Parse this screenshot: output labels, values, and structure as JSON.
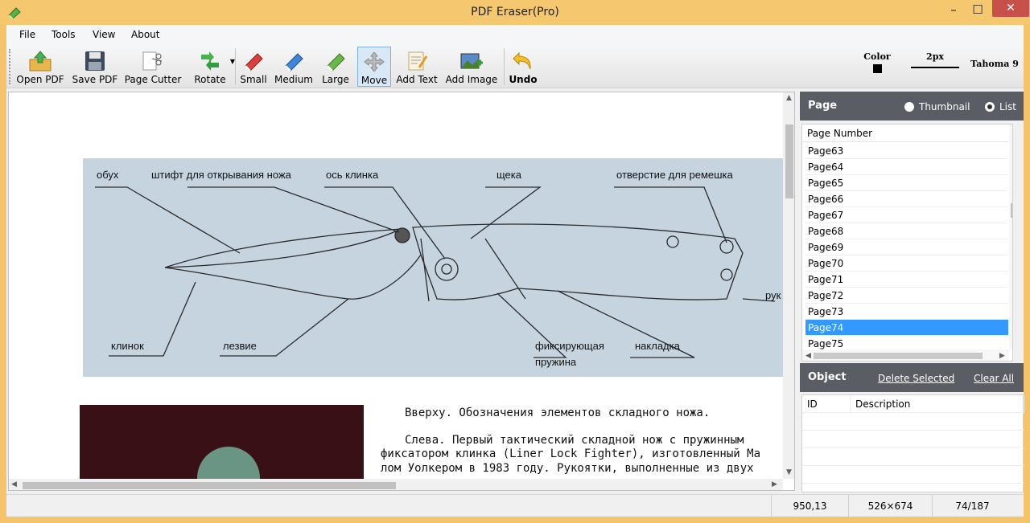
{
  "window": {
    "title": "PDF Eraser(Pro)",
    "min_glyph": "–",
    "max_glyph": "☐",
    "close_glyph": "✕"
  },
  "menu": [
    "File",
    "Tools",
    "View",
    "About"
  ],
  "toolbar": {
    "open_pdf": "Open PDF",
    "save_pdf": "Save PDF",
    "page_cutter": "Page Cutter",
    "rotate": "Rotate",
    "small": "Small",
    "medium": "Medium",
    "large": "Large",
    "move": "Move",
    "add_text": "Add Text",
    "add_image": "Add Image",
    "undo": "Undo",
    "color_label": "Color",
    "size_label": "2px",
    "font_label": "Tahoma 9"
  },
  "document": {
    "labels": {
      "obukh": "обух",
      "shtift": "штифт для открывания ножа",
      "os": "ось клинка",
      "scheka": "щека",
      "otverstie": "отверстие для ремешка",
      "ruk": "рук",
      "klinok": "клинок",
      "lezvie": "лезвие",
      "fiks1": "фиксирующая",
      "fiks2": "пружина",
      "nakladka": "накладка"
    },
    "text": [
      "Вверху. Обозначения элементов складного ножа.",
      "Слева. Первый тактический складной нож с пружинным",
      "фиксатором клинка (Liner Lock Fighter), изготовленный Ма",
      "лом Уолкером в 1983 году. Рукоятки, выполненные из двух"
    ]
  },
  "sidebar": {
    "page_title": "Page",
    "view_options": [
      {
        "label": "Thumbnail",
        "selected": false
      },
      {
        "label": "List",
        "selected": true
      }
    ],
    "list_header": "Page Number",
    "pages": [
      "Page63",
      "Page64",
      "Page65",
      "Page66",
      "Page67",
      "Page68",
      "Page69",
      "Page70",
      "Page71",
      "Page72",
      "Page73",
      "Page74",
      "Page75"
    ],
    "selected_page": "Page74",
    "object_title": "Object",
    "delete_selected": "Delete Selected",
    "clear_all": "Clear All",
    "object_columns": [
      "ID",
      "Description"
    ]
  },
  "status": {
    "coords": "950,13",
    "size": "526×674",
    "page": "74/187"
  },
  "colors": {
    "accent_selection": "#3399ff",
    "panel_header": "#5a5e64",
    "window_frame": "#f5c76e"
  }
}
